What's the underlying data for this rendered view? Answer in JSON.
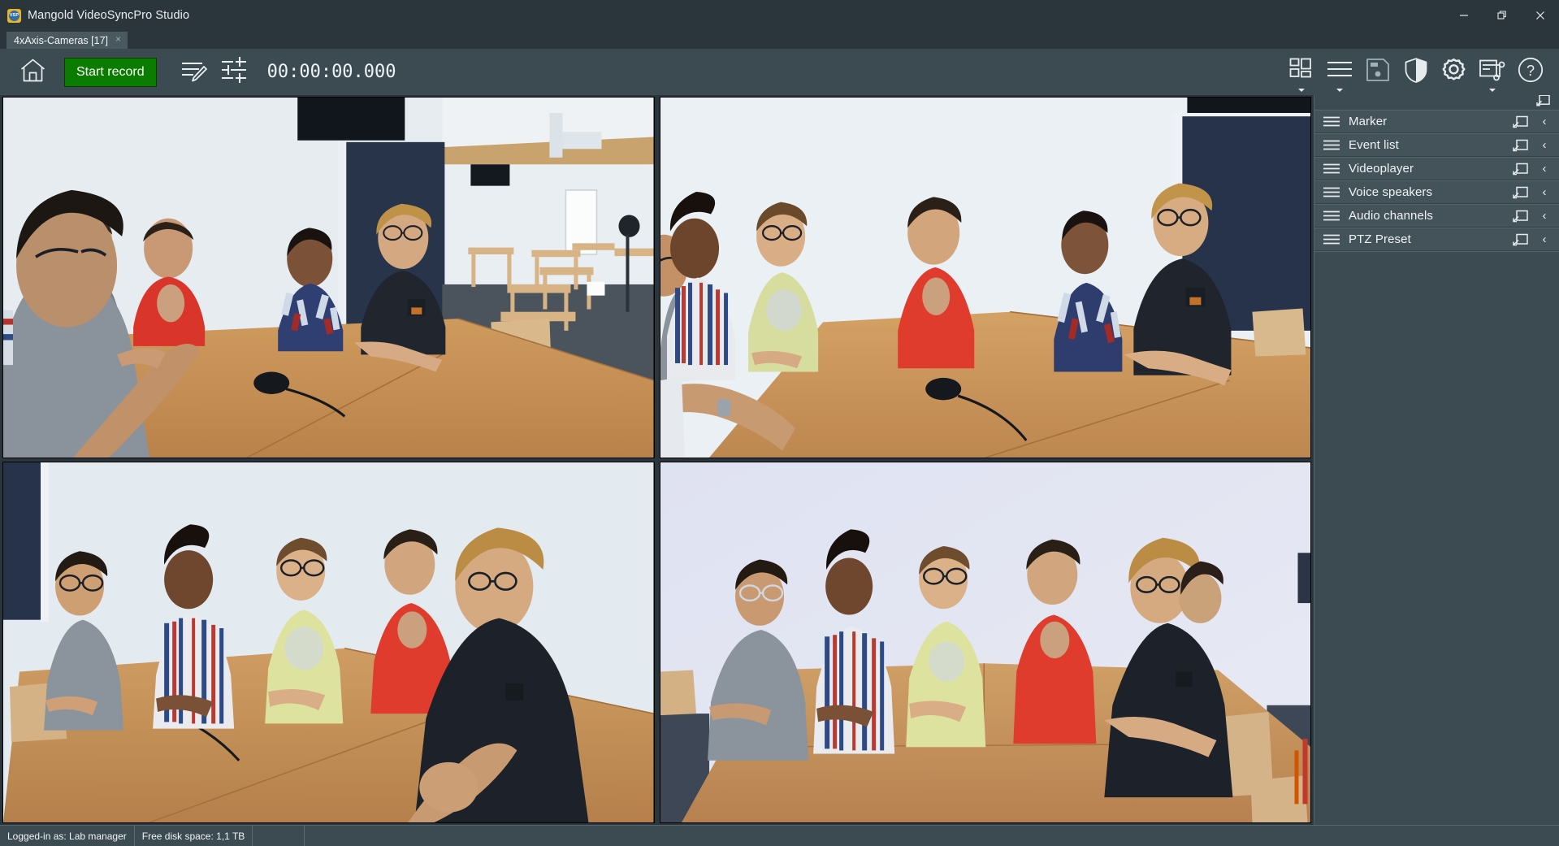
{
  "window": {
    "title": "Mangold VideoSyncPro Studio",
    "app_icon": "vsp-logo-icon",
    "icon_text": "VSP",
    "minimize_label": "—",
    "restore_label": "restore-icon",
    "close_label": "✕"
  },
  "tabs": [
    {
      "label": "4xAxis-Cameras [17]",
      "close": "×",
      "active": true
    }
  ],
  "toolbar": {
    "home_label": "home-icon",
    "start_record_label": "Start record",
    "annotate_label": "annotate-icon",
    "mixer_label": "mixer-icon",
    "timecode": "00:00:00.000",
    "right_icons": [
      {
        "name": "layout-grid-icon",
        "dropdown": true
      },
      {
        "name": "list-lines-icon",
        "dropdown": true
      },
      {
        "name": "save-floppy-icon",
        "dropdown": false
      },
      {
        "name": "shield-icon",
        "dropdown": false
      },
      {
        "name": "settings-gear-icon",
        "dropdown": false
      },
      {
        "name": "workflow-sitemap-icon",
        "dropdown": true
      },
      {
        "name": "help-question-icon",
        "dropdown": false
      }
    ]
  },
  "dock": {
    "undock_icon": "popout-icon",
    "items": [
      {
        "label": "Marker",
        "popout": "popout-icon",
        "chevron": "‹"
      },
      {
        "label": "Event list",
        "popout": "popout-icon",
        "chevron": "‹"
      },
      {
        "label": "Videoplayer",
        "popout": "popout-icon",
        "chevron": "‹"
      },
      {
        "label": "Voice speakers",
        "popout": "popout-icon",
        "chevron": "‹"
      },
      {
        "label": "Audio channels",
        "popout": "popout-icon",
        "chevron": "‹"
      },
      {
        "label": "PTZ Preset",
        "popout": "popout-icon",
        "chevron": "‹"
      }
    ]
  },
  "video_grid": {
    "layout": "2x2",
    "cells": [
      {
        "name": "camera-view-1",
        "scene": "meeting-room-side-angle",
        "tint": "#e8eef2"
      },
      {
        "name": "camera-view-2",
        "scene": "meeting-room-front-left",
        "tint": "#eaf0f4"
      },
      {
        "name": "camera-view-3",
        "scene": "meeting-room-rear-angle",
        "tint": "#e4ebf0"
      },
      {
        "name": "camera-view-4",
        "scene": "meeting-room-wide-front",
        "tint": "#dfe4f2"
      }
    ]
  },
  "statusbar": {
    "logged_in": "Logged-in as: Lab manager",
    "disk_space": "Free disk space: 1,1 TB",
    "cell3": "",
    "cell4": ""
  },
  "colors": {
    "chrome": "#3c4b52",
    "titlebar": "#2b363c",
    "record_green": "#0a7d00",
    "panel_row": "#44535a",
    "text": "#eef3f5"
  }
}
